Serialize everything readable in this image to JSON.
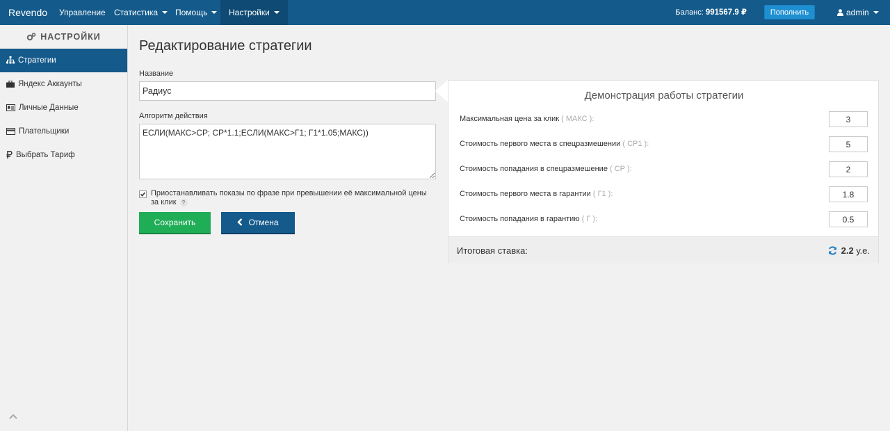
{
  "navbar": {
    "brand": "Revendo",
    "items": [
      {
        "label": "Управление"
      },
      {
        "label": "Статистика"
      },
      {
        "label": "Помощь"
      },
      {
        "label": "Настройки"
      }
    ],
    "balance_label": "Баланс:",
    "balance_value": "991567.9 ₽",
    "topup_label": "Пополнить",
    "user_name": "admin"
  },
  "sidebar": {
    "title": "НАСТРОЙКИ",
    "items": [
      {
        "label": "Стратегии",
        "icon": "sitemap-icon"
      },
      {
        "label": "Яндекс Аккаунты",
        "icon": "briefcase-icon"
      },
      {
        "label": "Личные Данные",
        "icon": "id-card-icon"
      },
      {
        "label": "Плательщики",
        "icon": "credit-card-icon"
      },
      {
        "label": "Выбрать Тариф",
        "icon": "ruble-icon"
      }
    ]
  },
  "page": {
    "title": "Редактирование стратегии",
    "name_label": "Название",
    "name_value": "Радиус",
    "algo_label": "Алгоритм действия",
    "algo_value": "ЕСЛИ(МАКС>СР; СР*1.1;ЕСЛИ(МАКС>Г1; Г1*1.05;МАКС))",
    "checkbox_text": "Приостанавливать показы по фразе при превышении её максимальной цены за клик",
    "help_badge": "?",
    "save_label": "Сохранить",
    "cancel_label": "Отмена"
  },
  "demo": {
    "title": "Демонстрация работы стратегии",
    "rows": [
      {
        "label": "Максимальная цена за клик",
        "code": "( МАКС ):",
        "value": "3"
      },
      {
        "label": "Стоимость первого места в спецразмешении",
        "code": "( СР1 ):",
        "value": "5"
      },
      {
        "label": "Стоимость попадания в спецразмешение",
        "code": "( СР ):",
        "value": "2"
      },
      {
        "label": "Стоимость первого места в гарантии",
        "code": "( Г1 ):",
        "value": "1.8"
      },
      {
        "label": "Стоимость попадания в гарантию",
        "code": "( Г ):",
        "value": "0.5"
      }
    ],
    "total_label": "Итоговая ставка:",
    "total_value": "2.2",
    "total_unit": "у.е."
  },
  "colors": {
    "primary": "#145a8b",
    "success": "#1fad56",
    "topup": "#1e90d2"
  }
}
